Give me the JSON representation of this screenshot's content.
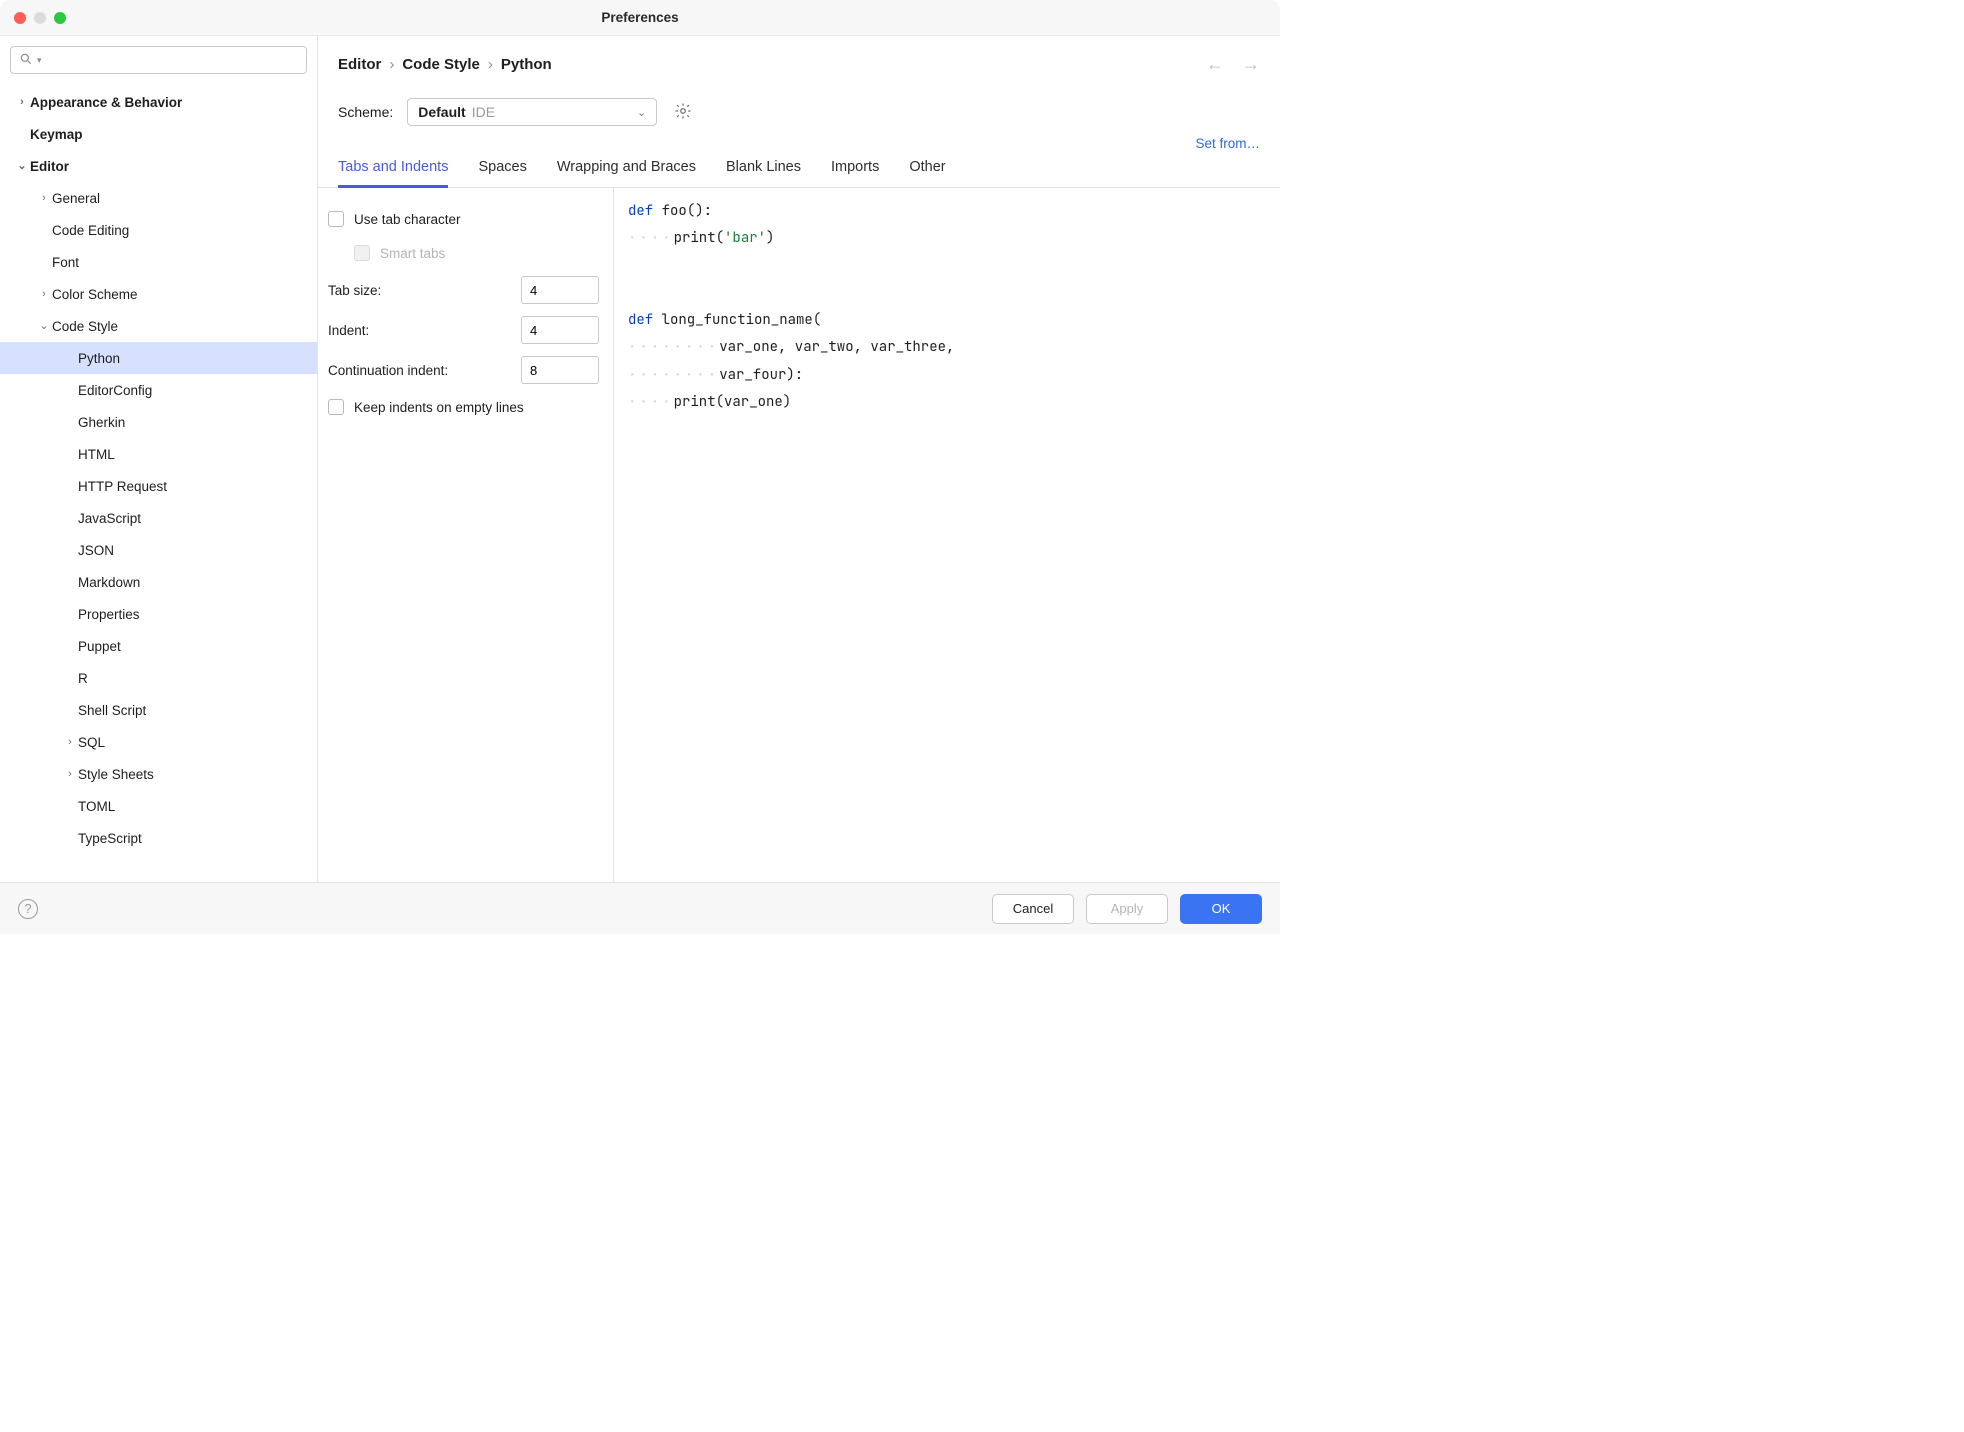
{
  "window": {
    "title": "Preferences"
  },
  "sidebar": {
    "search_placeholder": "",
    "items": [
      {
        "label": "Appearance & Behavior",
        "bold": true,
        "arrow": "right",
        "pad": 0
      },
      {
        "label": "Keymap",
        "bold": true,
        "arrow": "",
        "pad": 0
      },
      {
        "label": "Editor",
        "bold": true,
        "arrow": "down",
        "pad": 0
      },
      {
        "label": "General",
        "arrow": "right",
        "pad": 1
      },
      {
        "label": "Code Editing",
        "arrow": "",
        "pad": 1
      },
      {
        "label": "Font",
        "arrow": "",
        "pad": 1
      },
      {
        "label": "Color Scheme",
        "arrow": "right",
        "pad": 1
      },
      {
        "label": "Code Style",
        "arrow": "down",
        "pad": 1
      },
      {
        "label": "Python",
        "arrow": "",
        "pad": 2,
        "selected": true
      },
      {
        "label": "EditorConfig",
        "arrow": "",
        "pad": 2
      },
      {
        "label": "Gherkin",
        "arrow": "",
        "pad": 2
      },
      {
        "label": "HTML",
        "arrow": "",
        "pad": 2
      },
      {
        "label": "HTTP Request",
        "arrow": "",
        "pad": 2
      },
      {
        "label": "JavaScript",
        "arrow": "",
        "pad": 2
      },
      {
        "label": "JSON",
        "arrow": "",
        "pad": 2
      },
      {
        "label": "Markdown",
        "arrow": "",
        "pad": 2
      },
      {
        "label": "Properties",
        "arrow": "",
        "pad": 2
      },
      {
        "label": "Puppet",
        "arrow": "",
        "pad": 2
      },
      {
        "label": "R",
        "arrow": "",
        "pad": 2
      },
      {
        "label": "Shell Script",
        "arrow": "",
        "pad": 2
      },
      {
        "label": "SQL",
        "arrow": "right",
        "pad": 2
      },
      {
        "label": "Style Sheets",
        "arrow": "right",
        "pad": 2
      },
      {
        "label": "TOML",
        "arrow": "",
        "pad": 2
      },
      {
        "label": "TypeScript",
        "arrow": "",
        "pad": 2
      }
    ]
  },
  "breadcrumb": {
    "a": "Editor",
    "b": "Code Style",
    "c": "Python"
  },
  "scheme": {
    "label": "Scheme:",
    "value": "Default",
    "tag": "IDE"
  },
  "setfrom": "Set from…",
  "tabs": [
    "Tabs and Indents",
    "Spaces",
    "Wrapping and Braces",
    "Blank Lines",
    "Imports",
    "Other"
  ],
  "form": {
    "use_tab": "Use tab character",
    "smart_tabs": "Smart tabs",
    "tab_size_label": "Tab size:",
    "tab_size": "4",
    "indent_label": "Indent:",
    "indent": "4",
    "cont_label": "Continuation indent:",
    "cont": "8",
    "keep_empty": "Keep indents on empty lines"
  },
  "preview": {
    "l1_kw": "def",
    "l1_fn": " foo():",
    "l2_ws": "····",
    "l2_c": "print(",
    "l2_str": "'bar'",
    "l2_e": ")",
    "l3_kw": "def",
    "l3_fn": " long_function_name(",
    "l4_ws": "········",
    "l4_c": "var_one, var_two, var_three,",
    "l5_ws": "········",
    "l5_c": "var_four):",
    "l6_ws": "····",
    "l6_c": "print(var_one)"
  },
  "footer": {
    "cancel": "Cancel",
    "apply": "Apply",
    "ok": "OK"
  }
}
